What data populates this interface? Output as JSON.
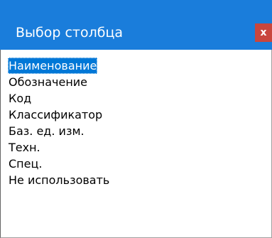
{
  "dialog": {
    "title": "Выбор столбца",
    "close_label": "x",
    "colors": {
      "titlebar": "#1a7ddb",
      "close_button": "#c9463d",
      "selection": "#0078d7"
    }
  },
  "list": {
    "selected_index": 0,
    "items": [
      {
        "label": "Наименование",
        "selected": true
      },
      {
        "label": "Обозначение",
        "selected": false
      },
      {
        "label": "Код",
        "selected": false
      },
      {
        "label": "Классификатор",
        "selected": false
      },
      {
        "label": "Баз. ед. изм.",
        "selected": false
      },
      {
        "label": "Техн.",
        "selected": false
      },
      {
        "label": "Спец.",
        "selected": false
      },
      {
        "label": "Не использовать",
        "selected": false
      }
    ]
  }
}
